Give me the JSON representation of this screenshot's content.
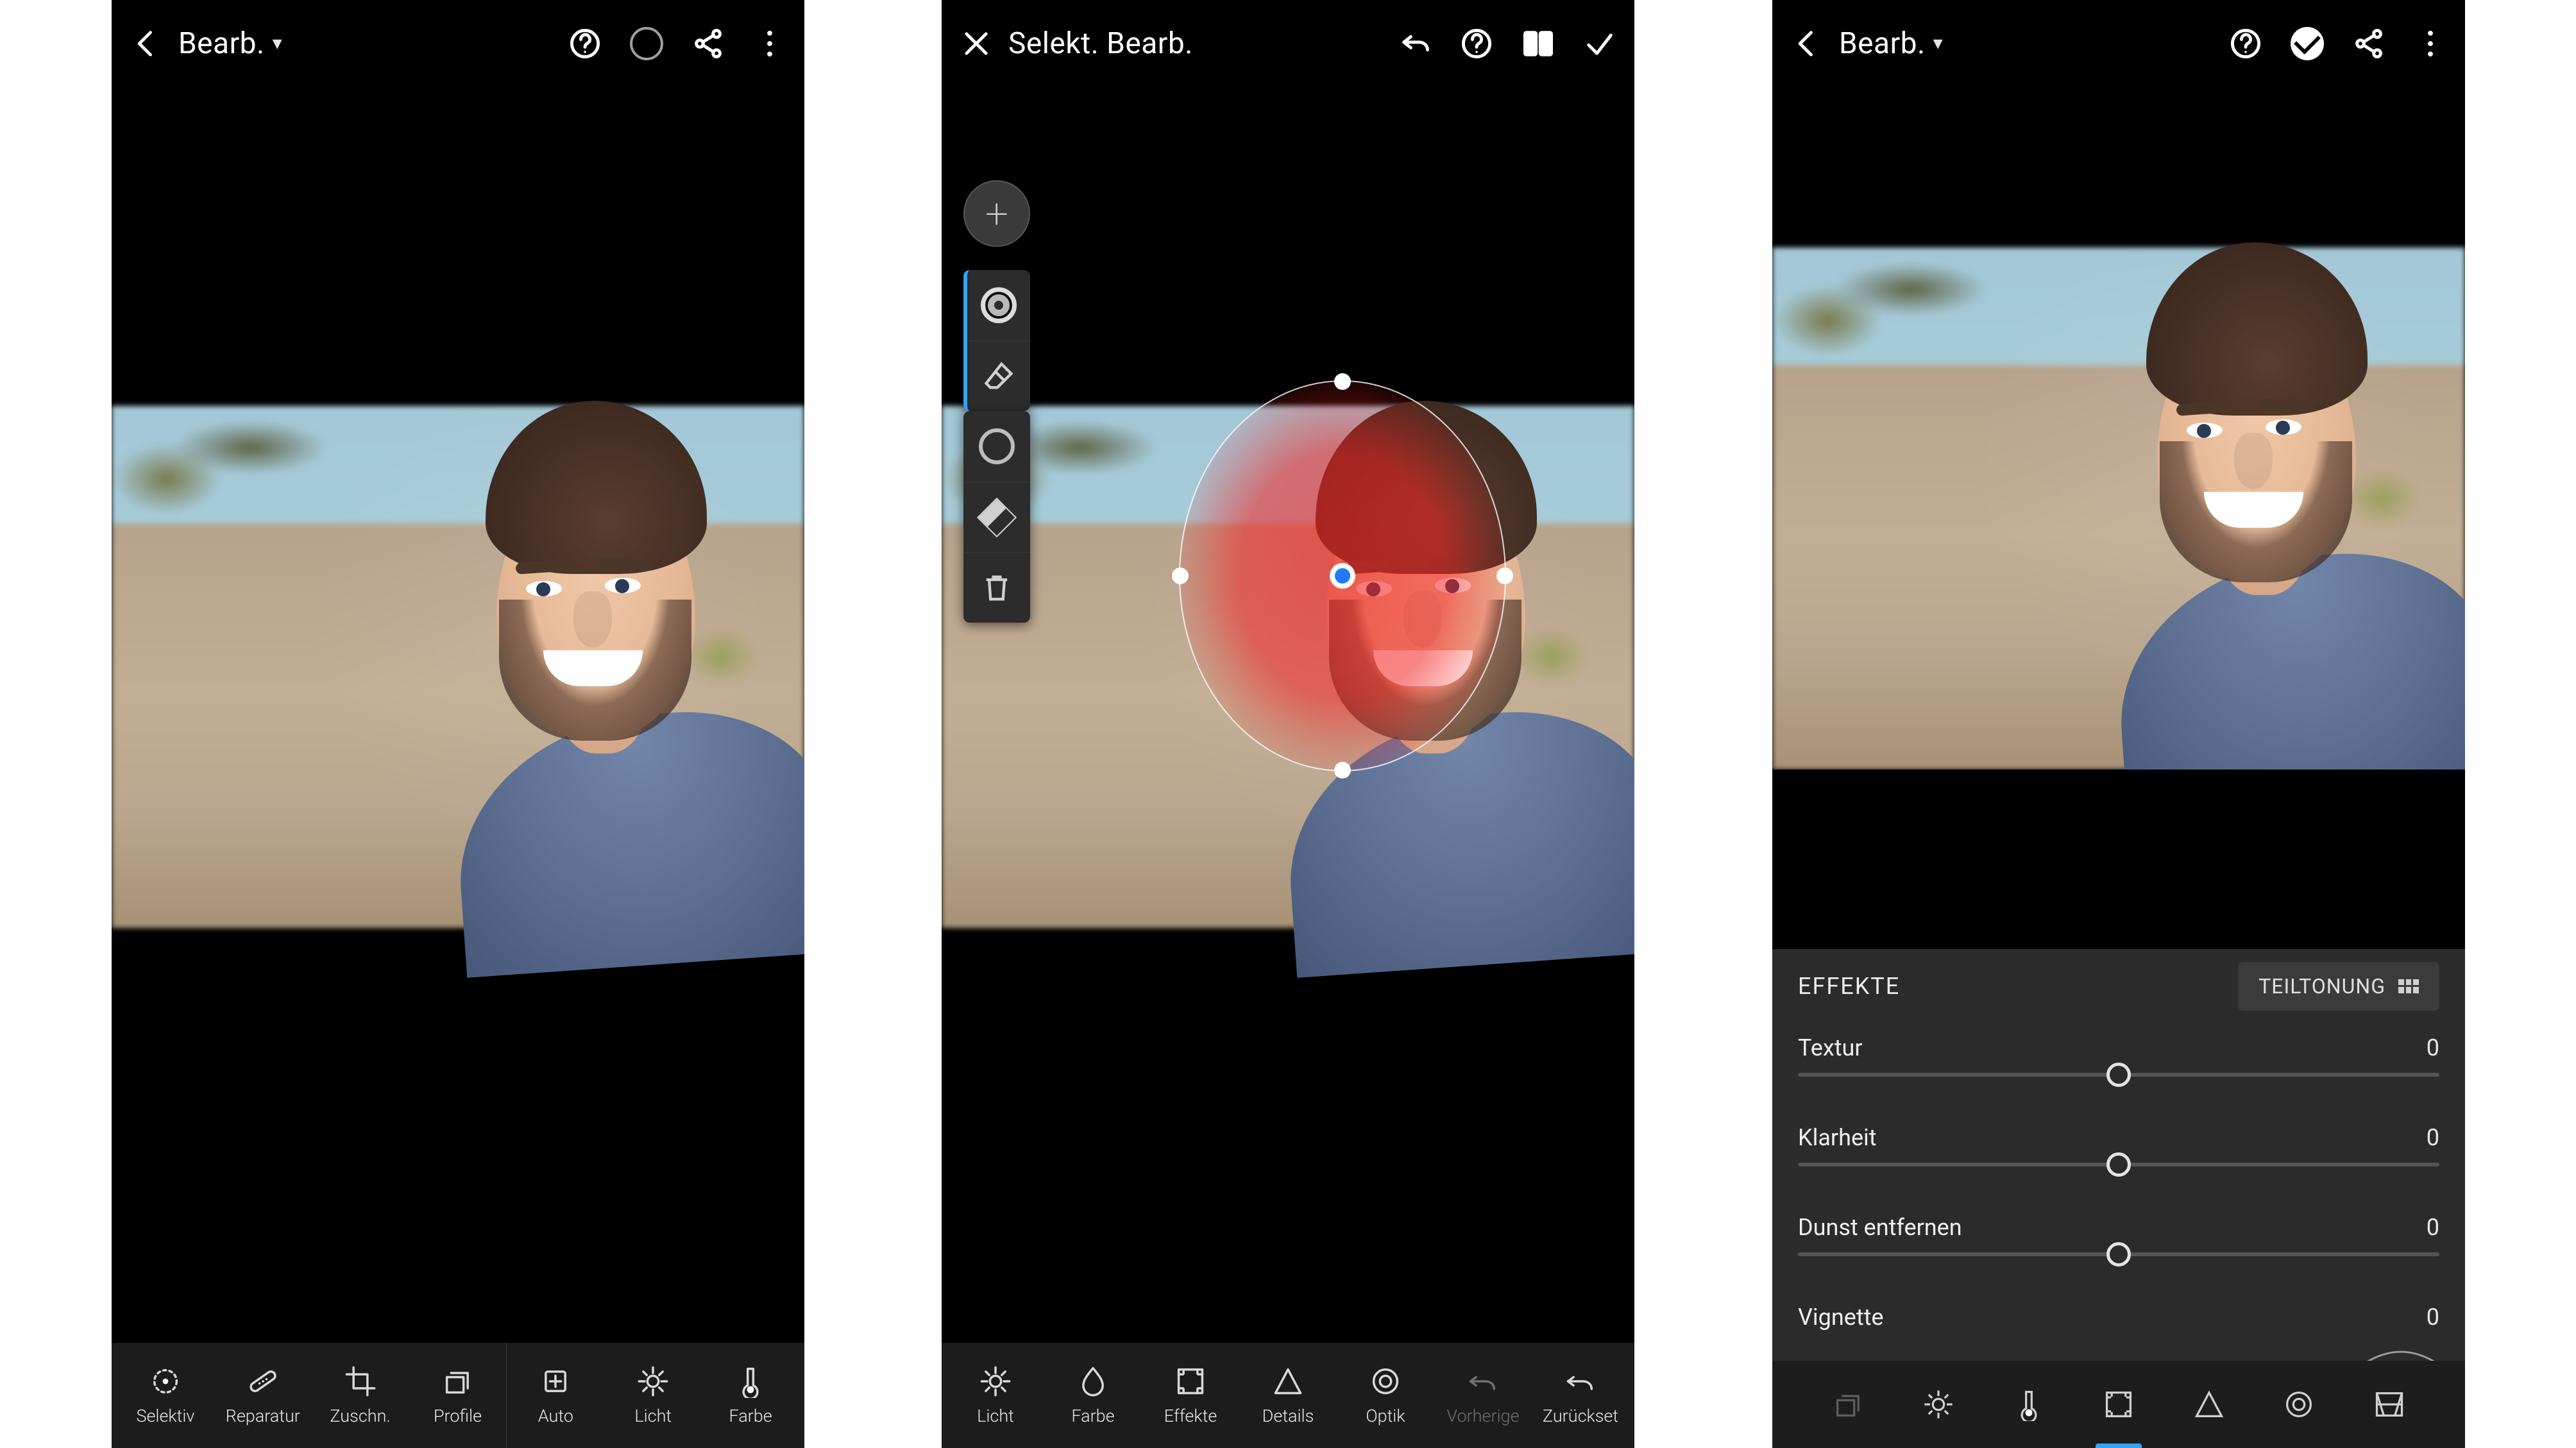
{
  "panel1": {
    "title": "Bearb.",
    "toolbar": [
      {
        "id": "selective",
        "label": "Selektiv"
      },
      {
        "id": "repair",
        "label": "Reparatur"
      },
      {
        "id": "crop",
        "label": "Zuschn."
      },
      {
        "id": "profiles",
        "label": "Profile"
      },
      {
        "id": "auto",
        "label": "Auto"
      },
      {
        "id": "light",
        "label": "Licht"
      },
      {
        "id": "color",
        "label": "Farbe"
      }
    ]
  },
  "panel2": {
    "title": "Selekt. Bearb.",
    "add_label": "+",
    "toolbar": [
      {
        "id": "light",
        "label": "Licht"
      },
      {
        "id": "color",
        "label": "Farbe"
      },
      {
        "id": "effects",
        "label": "Effekte"
      },
      {
        "id": "details",
        "label": "Details"
      },
      {
        "id": "optics",
        "label": "Optik"
      },
      {
        "id": "previous",
        "label": "Vorherige"
      },
      {
        "id": "reset",
        "label": "Zurückset"
      }
    ]
  },
  "panel3": {
    "title": "Bearb.",
    "effects_header": "EFFEKTE",
    "split_toning": "TEILTONUNG",
    "sliders": [
      {
        "id": "texture",
        "label": "Textur",
        "value": "0"
      },
      {
        "id": "clarity",
        "label": "Klarheit",
        "value": "0"
      },
      {
        "id": "dehaze",
        "label": "Dunst entfernen",
        "value": "0"
      },
      {
        "id": "vignette",
        "label": "Vignette",
        "value": "0"
      }
    ],
    "tab_icons": [
      "profiles",
      "light",
      "temperature",
      "effects",
      "details",
      "optics",
      "geometry"
    ],
    "active_tab": "effects"
  }
}
